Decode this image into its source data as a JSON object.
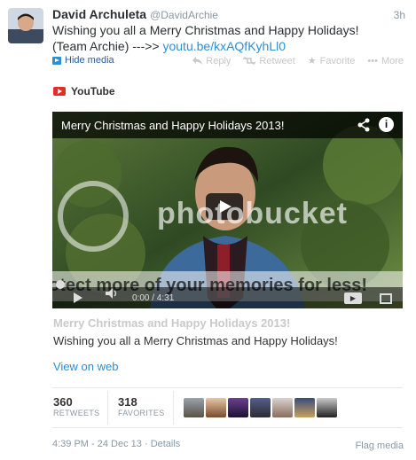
{
  "tweet": {
    "author_name": "David Archuleta",
    "author_handle": "@DavidArchie",
    "time": "3h",
    "text_main": "Wishing you all a Merry Christmas and Happy Holidays! (Team Archie) --->> ",
    "link": "youtu.be/kxAQfKyhLl0",
    "hide_media": "Hide media",
    "actions": {
      "reply": "Reply",
      "retweet": "Retweet",
      "favorite": "Favorite",
      "more": "More"
    }
  },
  "media": {
    "source": "YouTube",
    "video_title": "Merry Christmas and Happy Holidays 2013!",
    "video_time": "0:00 / 4:31",
    "watermark": "photobucket",
    "watermark_tagline": "otect more of your memories for less!",
    "card_title": "Merry Christmas and Happy Holidays 2013!",
    "card_description": "Wishing you all a Merry Christmas and Happy Holidays!",
    "view_on_web": "View on web"
  },
  "stats": {
    "retweets_count": "360",
    "retweets_label": "RETWEETS",
    "favorites_count": "318",
    "favorites_label": "FAVORITES"
  },
  "footer": {
    "timestamp": "4:39 PM - 24 Dec 13",
    "separator": "·",
    "details": "Details",
    "flag": "Flag media"
  },
  "colors": {
    "link": "#2a8fd4",
    "youtube_red": "#e52d27",
    "muted": "#8899a6"
  }
}
